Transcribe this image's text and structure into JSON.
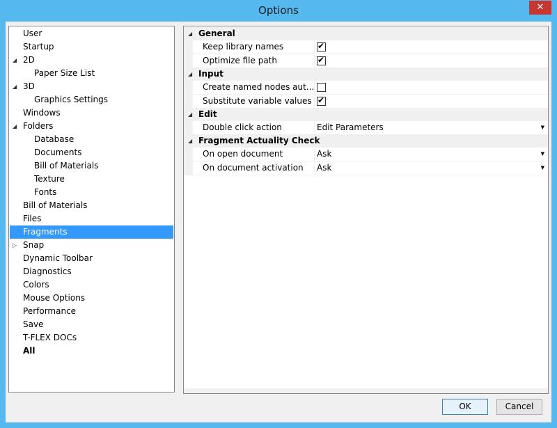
{
  "window": {
    "title": "Options",
    "close_symbol": "✕"
  },
  "tree": {
    "items": [
      {
        "label": "User",
        "level": 0,
        "expander": "",
        "selected": false,
        "bold": false
      },
      {
        "label": "Startup",
        "level": 0,
        "expander": "",
        "selected": false,
        "bold": false
      },
      {
        "label": "2D",
        "level": 0,
        "expander": "expanded",
        "selected": false,
        "bold": false
      },
      {
        "label": "Paper Size List",
        "level": 1,
        "expander": "",
        "selected": false,
        "bold": false
      },
      {
        "label": "3D",
        "level": 0,
        "expander": "expanded",
        "selected": false,
        "bold": false
      },
      {
        "label": "Graphics Settings",
        "level": 1,
        "expander": "",
        "selected": false,
        "bold": false
      },
      {
        "label": "Windows",
        "level": 0,
        "expander": "",
        "selected": false,
        "bold": false
      },
      {
        "label": "Folders",
        "level": 0,
        "expander": "expanded",
        "selected": false,
        "bold": false
      },
      {
        "label": "Database",
        "level": 1,
        "expander": "",
        "selected": false,
        "bold": false
      },
      {
        "label": "Documents",
        "level": 1,
        "expander": "",
        "selected": false,
        "bold": false
      },
      {
        "label": "Bill of Materials",
        "level": 1,
        "expander": "",
        "selected": false,
        "bold": false
      },
      {
        "label": "Texture",
        "level": 1,
        "expander": "",
        "selected": false,
        "bold": false
      },
      {
        "label": "Fonts",
        "level": 1,
        "expander": "",
        "selected": false,
        "bold": false
      },
      {
        "label": "Bill of Materials",
        "level": 0,
        "expander": "",
        "selected": false,
        "bold": false
      },
      {
        "label": "Files",
        "level": 0,
        "expander": "",
        "selected": false,
        "bold": false
      },
      {
        "label": "Fragments",
        "level": 0,
        "expander": "",
        "selected": true,
        "bold": false
      },
      {
        "label": "Snap",
        "level": 0,
        "expander": "collapsed",
        "selected": false,
        "bold": false
      },
      {
        "label": "Dynamic Toolbar",
        "level": 0,
        "expander": "",
        "selected": false,
        "bold": false
      },
      {
        "label": "Diagnostics",
        "level": 0,
        "expander": "",
        "selected": false,
        "bold": false
      },
      {
        "label": "Colors",
        "level": 0,
        "expander": "",
        "selected": false,
        "bold": false
      },
      {
        "label": "Mouse Options",
        "level": 0,
        "expander": "",
        "selected": false,
        "bold": false
      },
      {
        "label": "Performance",
        "level": 0,
        "expander": "",
        "selected": false,
        "bold": false
      },
      {
        "label": "Save",
        "level": 0,
        "expander": "",
        "selected": false,
        "bold": false
      },
      {
        "label": "T-FLEX DOCs",
        "level": 0,
        "expander": "",
        "selected": false,
        "bold": false
      },
      {
        "label": "All",
        "level": 0,
        "expander": "",
        "selected": false,
        "bold": true
      }
    ],
    "selection_color": "#3399ff"
  },
  "properties": {
    "categories": [
      {
        "label": "General",
        "rows": [
          {
            "name": "Keep library names",
            "type": "checkbox",
            "checked": true
          },
          {
            "name": "Optimize file path",
            "type": "checkbox",
            "checked": true
          }
        ]
      },
      {
        "label": "Input",
        "rows": [
          {
            "name": "Create named nodes aut...",
            "type": "checkbox",
            "checked": false
          },
          {
            "name": "Substitute variable values",
            "type": "checkbox",
            "checked": true
          }
        ]
      },
      {
        "label": "Edit",
        "rows": [
          {
            "name": "Double click action",
            "type": "dropdown",
            "value": "Edit Parameters"
          }
        ]
      },
      {
        "label": "Fragment Actuality Check",
        "rows": [
          {
            "name": "On open document",
            "type": "dropdown",
            "value": "Ask"
          },
          {
            "name": "On document activation",
            "type": "dropdown",
            "value": "Ask"
          }
        ]
      }
    ],
    "check_symbol": "✔",
    "dropdown_symbol": "▼",
    "expanded_symbol": "◢",
    "collapsed_symbol": "▷"
  },
  "buttons": {
    "ok_label": "OK",
    "cancel_label": "Cancel"
  },
  "colors": {
    "title_bar": "#55b8ee",
    "close_button": "#c7372f"
  }
}
